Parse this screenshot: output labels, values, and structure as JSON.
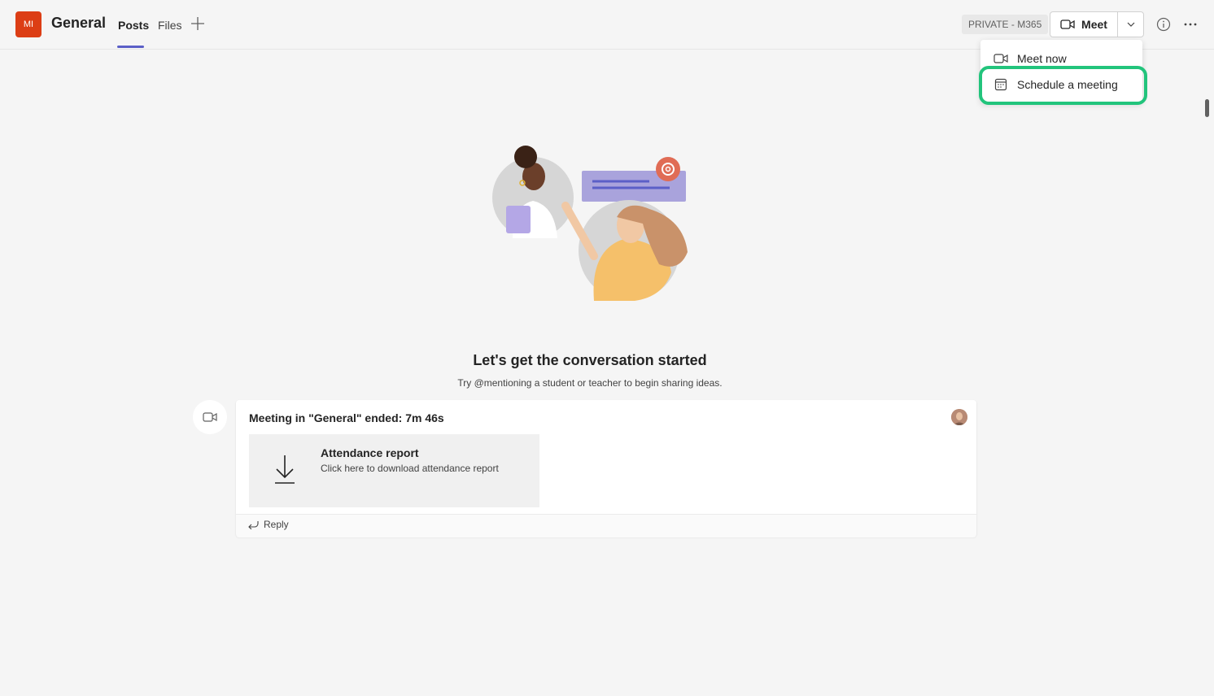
{
  "header": {
    "team_initials": "MI",
    "channel_title": "General",
    "tabs": [
      {
        "label": "Posts",
        "active": true
      },
      {
        "label": "Files",
        "active": false
      }
    ],
    "privacy_badge": "PRIVATE - M365",
    "meet_label": "Meet"
  },
  "meet_menu": {
    "items": [
      {
        "label": "Meet now",
        "icon": "video-camera-icon"
      },
      {
        "label": "Schedule a meeting",
        "icon": "calendar-icon",
        "highlighted": true
      }
    ]
  },
  "empty_state": {
    "title": "Let's get the conversation started",
    "subtitle": "Try @mentioning a student or teacher to begin sharing ideas."
  },
  "post": {
    "title": "Meeting in \"General\" ended: 7m 46s",
    "attachment": {
      "title": "Attendance report",
      "subtitle": "Click here to download attendance report"
    },
    "reply_label": "Reply"
  },
  "colors": {
    "accent": "#5b5fc7",
    "team_avatar": "#dc3e15",
    "highlight": "#22c47c"
  }
}
